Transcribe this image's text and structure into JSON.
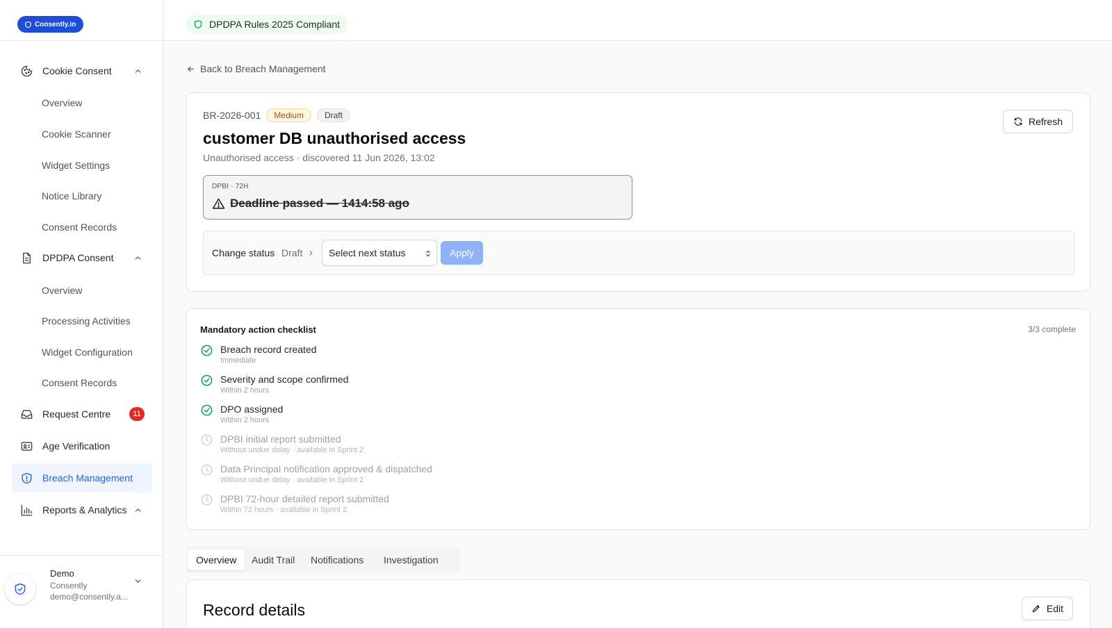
{
  "brand": {
    "logo_text": "Consently.in"
  },
  "topbar": {
    "compliance_label": "DPDPA Rules 2025 Compliant"
  },
  "sidebar": {
    "cookie_consent": {
      "label": "Cookie Consent",
      "items": [
        "Overview",
        "Cookie Scanner",
        "Widget Settings",
        "Notice Library",
        "Consent Records"
      ]
    },
    "dpdpa_consent": {
      "label": "DPDPA Consent",
      "items": [
        "Overview",
        "Processing Activities",
        "Widget Configuration",
        "Consent Records"
      ]
    },
    "request_centre": {
      "label": "Request Centre",
      "badge": "11"
    },
    "age_verification": {
      "label": "Age Verification"
    },
    "breach_management": {
      "label": "Breach Management"
    },
    "reports_analytics": {
      "label": "Reports & Analytics"
    },
    "user": {
      "name": "Demo",
      "org": "Consently",
      "email": "demo@consently.a..."
    }
  },
  "back_link": "Back to Breach Management",
  "incident": {
    "id": "BR-2026-001",
    "severity": "Medium",
    "status": "Draft",
    "title": "customer DB unauthorised access",
    "subtitle": "Unauthorised access · discovered 11 Jun 2026, 13:02",
    "refresh_label": "Refresh",
    "deadline_label": "DPBI · 72H",
    "deadline_text": "Deadline passed — 1414:58 ago",
    "change_status_label": "Change status",
    "current_status": "Draft",
    "select_placeholder": "Select next status",
    "apply_label": "Apply"
  },
  "checklist": {
    "title": "Mandatory action checklist",
    "progress": "3/3 complete",
    "items": [
      {
        "label": "Breach record created",
        "sub": "Immediate",
        "done": true
      },
      {
        "label": "Severity and scope confirmed",
        "sub": "Within 2 hours",
        "done": true
      },
      {
        "label": "DPO assigned",
        "sub": "Within 2 hours",
        "done": true
      },
      {
        "label": "DPBI initial report submitted",
        "sub": "Without undue delay · available in Sprint 2",
        "done": false
      },
      {
        "label": "Data Principal notification approved & dispatched",
        "sub": "Without undue delay · available in Sprint 2",
        "done": false
      },
      {
        "label": "DPBI 72-hour detailed report submitted",
        "sub": "Within 72 hours · available in Sprint 2",
        "done": false
      }
    ]
  },
  "tabs": [
    "Overview",
    "Audit Trail",
    "Notifications",
    "Investigation"
  ],
  "record_details": {
    "title": "Record details",
    "edit_label": "Edit"
  }
}
